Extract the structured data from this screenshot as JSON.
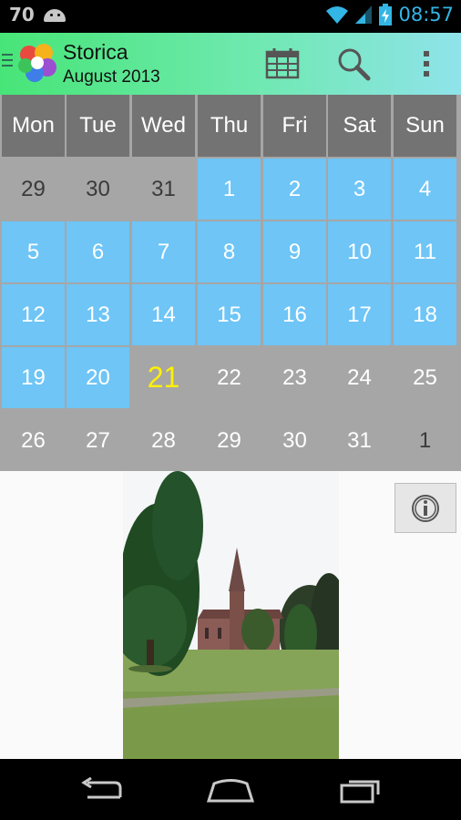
{
  "status_bar": {
    "battery_level": "70",
    "time": "08:57",
    "icons": [
      "android-debug-icon",
      "wifi-icon",
      "signal-icon",
      "battery-charging-icon"
    ]
  },
  "action_bar": {
    "title": "Storica",
    "subtitle": "August 2013",
    "actions": [
      "calendar-icon",
      "search-icon",
      "overflow-menu-icon"
    ]
  },
  "calendar": {
    "weekdays": [
      "Mon",
      "Tue",
      "Wed",
      "Thu",
      "Fri",
      "Sat",
      "Sun"
    ],
    "weeks": [
      [
        {
          "d": "29",
          "s": "out"
        },
        {
          "d": "30",
          "s": "out"
        },
        {
          "d": "31",
          "s": "out"
        },
        {
          "d": "1",
          "s": "in"
        },
        {
          "d": "2",
          "s": "in"
        },
        {
          "d": "3",
          "s": "in"
        },
        {
          "d": "4",
          "s": "in"
        }
      ],
      [
        {
          "d": "5",
          "s": "in"
        },
        {
          "d": "6",
          "s": "in"
        },
        {
          "d": "7",
          "s": "in"
        },
        {
          "d": "8",
          "s": "in"
        },
        {
          "d": "9",
          "s": "in"
        },
        {
          "d": "10",
          "s": "in"
        },
        {
          "d": "11",
          "s": "in"
        }
      ],
      [
        {
          "d": "12",
          "s": "in"
        },
        {
          "d": "13",
          "s": "in"
        },
        {
          "d": "14",
          "s": "in"
        },
        {
          "d": "15",
          "s": "in"
        },
        {
          "d": "16",
          "s": "in"
        },
        {
          "d": "17",
          "s": "in"
        },
        {
          "d": "18",
          "s": "in"
        }
      ],
      [
        {
          "d": "19",
          "s": "in"
        },
        {
          "d": "20",
          "s": "in"
        },
        {
          "d": "21",
          "s": "today"
        },
        {
          "d": "22",
          "s": "plain"
        },
        {
          "d": "23",
          "s": "plain"
        },
        {
          "d": "24",
          "s": "plain"
        },
        {
          "d": "25",
          "s": "plain"
        }
      ],
      [
        {
          "d": "26",
          "s": "plain"
        },
        {
          "d": "27",
          "s": "plain"
        },
        {
          "d": "28",
          "s": "plain"
        },
        {
          "d": "29",
          "s": "plain"
        },
        {
          "d": "30",
          "s": "plain"
        },
        {
          "d": "31",
          "s": "plain"
        },
        {
          "d": "1",
          "s": "out"
        }
      ]
    ],
    "colors": {
      "with_entry": "#6ec5f6",
      "header": "#737373",
      "today_text": "#fff000",
      "background": "#a6a6a6"
    }
  },
  "content": {
    "photo_icon": "park-church-photo",
    "info_icon": "info-icon"
  },
  "nav_bar": {
    "icons": [
      "back-icon",
      "home-icon",
      "recent-apps-icon"
    ]
  }
}
